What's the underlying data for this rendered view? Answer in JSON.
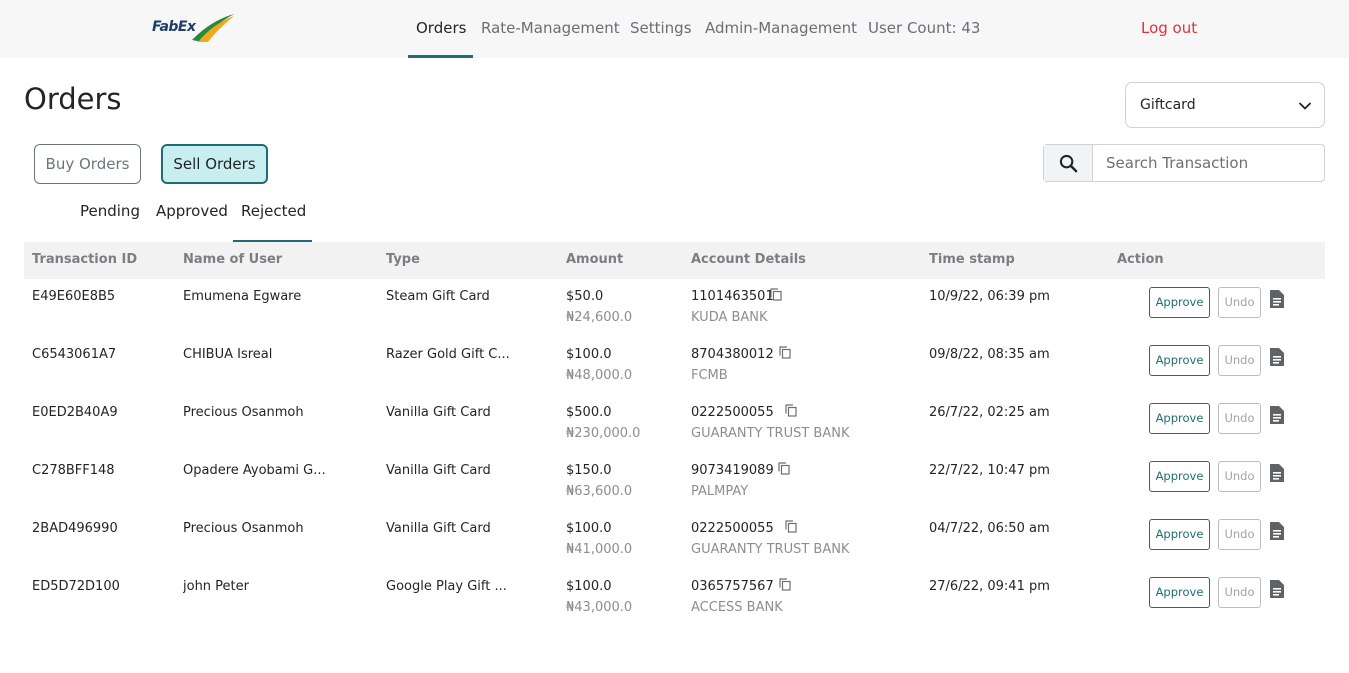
{
  "brand": {
    "logo_text": "FabEx"
  },
  "nav": {
    "items": [
      "Orders",
      "Rate-Management",
      "Settings",
      "Admin-Management",
      "User Count: 43"
    ],
    "logout": "Log out"
  },
  "page": {
    "title": "Orders",
    "category_select": "Giftcard",
    "buy_orders_label": "Buy Orders",
    "sell_orders_label": "Sell Orders",
    "search_placeholder": "Search Transaction",
    "subtabs": [
      "Pending",
      "Approved",
      "Rejected"
    ],
    "active_subtab": "Rejected"
  },
  "table": {
    "headers": [
      "Transaction ID",
      "Name of User",
      "Type",
      "Amount",
      "Account Details",
      "Time stamp",
      "Action"
    ],
    "rows": [
      {
        "id": "E49E60E8B5",
        "name": "Emumena Egware",
        "type": "Steam Gift Card",
        "usd": "$50.0",
        "ngn": "₦24,600.0",
        "account": "1101463501",
        "bank": "KUDA BANK",
        "time": "10/9/22, 06:39 pm"
      },
      {
        "id": "C6543061A7",
        "name": "CHIBUA Isreal",
        "type": "Razer Gold Gift C...",
        "usd": "$100.0",
        "ngn": "₦48,000.0",
        "account": "8704380012",
        "bank": "FCMB",
        "time": "09/8/22, 08:35 am"
      },
      {
        "id": "E0ED2B40A9",
        "name": "Precious Osanmoh",
        "type": "Vanilla Gift Card",
        "usd": "$500.0",
        "ngn": "₦230,000.0",
        "account": "0222500055",
        "bank": "GUARANTY TRUST BANK",
        "time": "26/7/22, 02:25 am"
      },
      {
        "id": "C278BFF148",
        "name": "Opadere Ayobami G...",
        "type": "Vanilla Gift Card",
        "usd": "$150.0",
        "ngn": "₦63,600.0",
        "account": "9073419089",
        "bank": "PALMPAY",
        "time": "22/7/22, 10:47 pm"
      },
      {
        "id": "2BAD496990",
        "name": "Precious Osanmoh",
        "type": "Vanilla Gift Card",
        "usd": "$100.0",
        "ngn": "₦41,000.0",
        "account": "0222500055",
        "bank": "GUARANTY TRUST BANK",
        "time": "04/7/22, 06:50 am"
      },
      {
        "id": "ED5D72D100",
        "name": "john Peter",
        "type": "Google Play Gift ...",
        "usd": "$100.0",
        "ngn": "₦43,000.0",
        "account": "0365757567",
        "bank": "ACCESS BANK",
        "time": "27/6/22, 09:41 pm"
      }
    ],
    "approve_label": "Approve",
    "undo_label": "Undo"
  },
  "colors": {
    "accent": "#1e6f75",
    "logout": "#e0323a",
    "sell_bg": "#c9eef0"
  },
  "icons": {
    "search": "search-icon",
    "copy": "copy-icon",
    "document": "document-icon",
    "chevron": "chevron-down-icon"
  }
}
